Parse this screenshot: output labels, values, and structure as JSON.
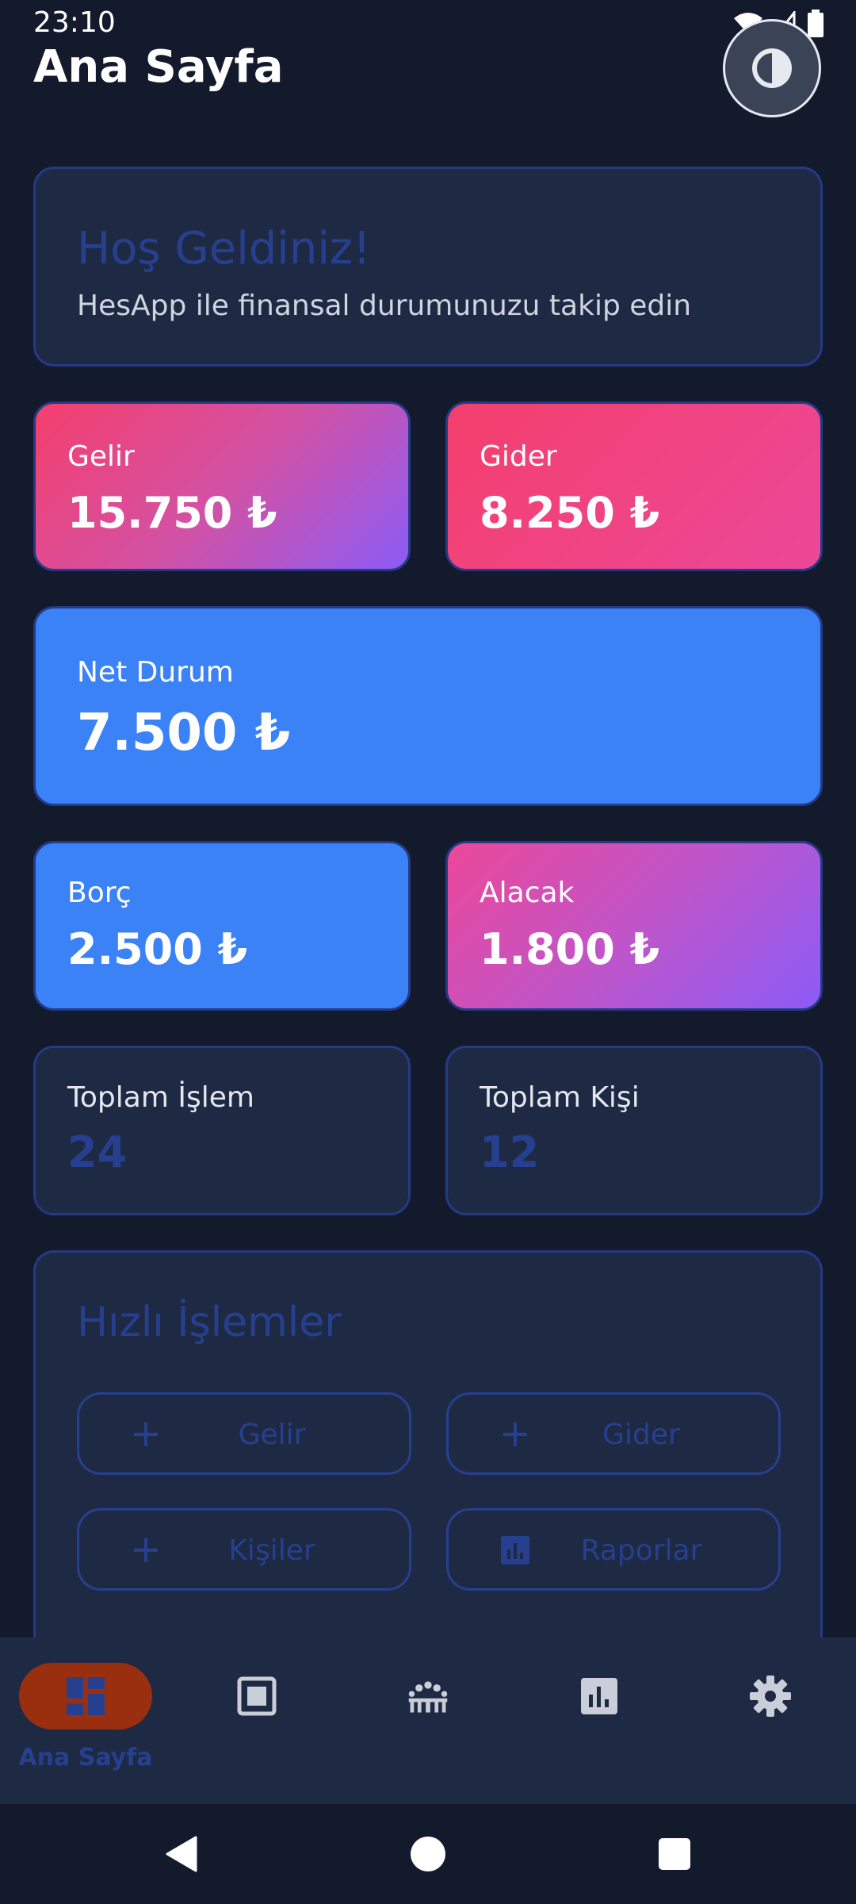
{
  "status_bar": {
    "time": "23:10"
  },
  "header": {
    "title": "Ana Sayfa",
    "theme_toggle_icon": "contrast-icon"
  },
  "welcome": {
    "title": "Hoş Geldiniz!",
    "subtitle": "HesApp ile finansal durumunuzu takip edin"
  },
  "stats": {
    "income": {
      "label": "Gelir",
      "value": "15.750 ₺"
    },
    "expense": {
      "label": "Gider",
      "value": "8.250 ₺"
    },
    "net": {
      "label": "Net Durum",
      "value": "7.500 ₺"
    },
    "debt": {
      "label": "Borç",
      "value": "2.500 ₺"
    },
    "receivable": {
      "label": "Alacak",
      "value": "1.800 ₺"
    },
    "total_transactions": {
      "label": "Toplam İşlem",
      "value": "24"
    },
    "total_people": {
      "label": "Toplam Kişi",
      "value": "12"
    }
  },
  "quick_actions": {
    "title": "Hızlı İşlemler",
    "buttons": [
      {
        "label": "Gelir",
        "icon": "plus-icon"
      },
      {
        "label": "Gider",
        "icon": "plus-icon"
      },
      {
        "label": "Kişiler",
        "icon": "plus-icon"
      },
      {
        "label": "Raporlar",
        "icon": "bar-chart-icon"
      }
    ]
  },
  "bottom_nav": {
    "items": [
      {
        "label": "Ana Sayfa",
        "icon": "dashboard-icon",
        "active": true
      },
      {
        "icon": "square-frame-icon"
      },
      {
        "icon": "people-icon"
      },
      {
        "icon": "bar-chart-icon"
      },
      {
        "icon": "gear-icon"
      }
    ]
  },
  "colors": {
    "background": "#121a2c",
    "card": "#1e2a44",
    "accent_dim": "#26408f",
    "blue": "#3b82f6",
    "pink": "#ec4899",
    "purple": "#8b5cf6",
    "active_pill": "#9a2f10"
  }
}
